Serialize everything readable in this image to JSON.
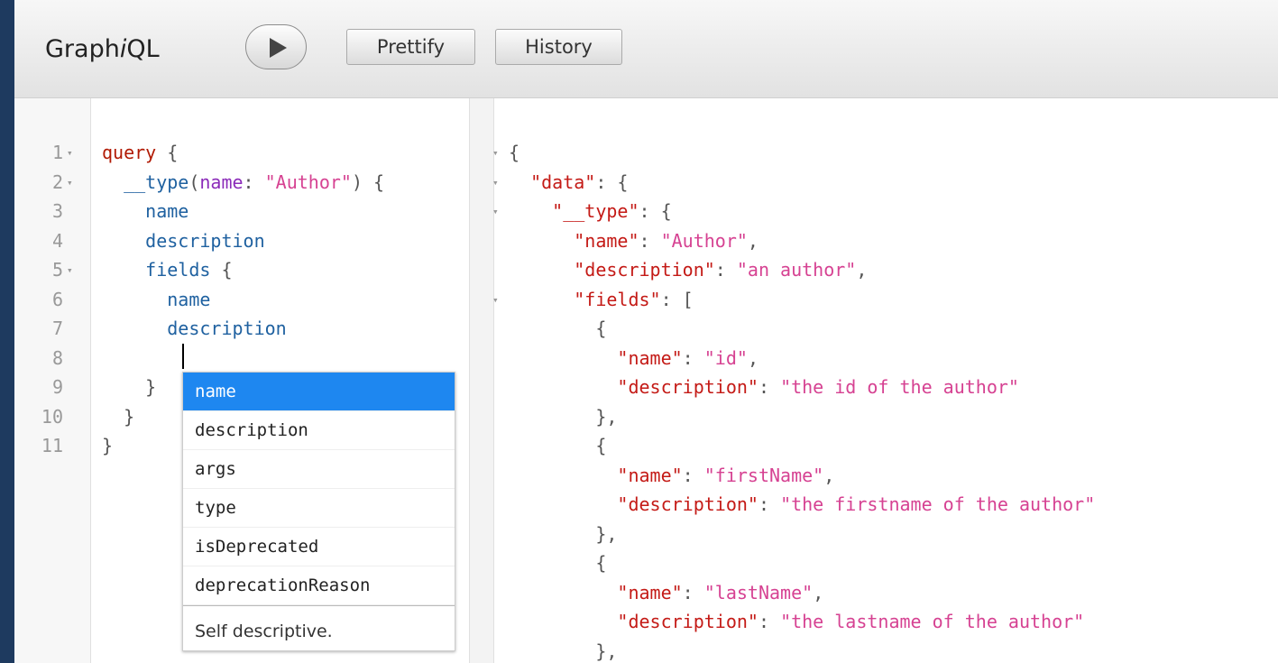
{
  "toolbar": {
    "logo_prefix": "Graph",
    "logo_i": "i",
    "logo_suffix": "QL",
    "prettify_label": "Prettify",
    "history_label": "History"
  },
  "editor": {
    "line_numbers": [
      "1",
      "2",
      "3",
      "4",
      "5",
      "6",
      "7",
      "8",
      "9",
      "10",
      "11"
    ],
    "lines": [
      [
        "query",
        " {"
      ],
      [
        "  __type",
        "(",
        "name",
        ": ",
        "\"Author\"",
        ") {"
      ],
      [
        "    name"
      ],
      [
        "    description"
      ],
      [
        "    fields",
        " {"
      ],
      [
        "      name"
      ],
      [
        "      description"
      ],
      [
        ""
      ],
      [
        "    }"
      ],
      [
        "  }"
      ],
      [
        "}"
      ]
    ]
  },
  "autocomplete": {
    "items": [
      "name",
      "description",
      "args",
      "type",
      "isDeprecated",
      "deprecationReason"
    ],
    "description": "Self descriptive."
  },
  "result": {
    "lines": [
      "{",
      "  \"data\": {",
      "    \"__type\": {",
      "      \"name\": \"Author\",",
      "      \"description\": \"an author\",",
      "      \"fields\": [",
      "        {",
      "          \"name\": \"id\",",
      "          \"description\": \"the id of the author\"",
      "        },",
      "        {",
      "          \"name\": \"firstName\",",
      "          \"description\": \"the firstname of the author\"",
      "        },",
      "        {",
      "          \"name\": \"lastName\",",
      "          \"description\": \"the lastname of the author\"",
      "        },"
    ],
    "folded_lines": [
      0,
      1,
      2,
      5
    ]
  },
  "colors": {
    "keyword": "#b11a04",
    "field": "#1f61a0",
    "attribute": "#8b2bb9",
    "string": "#d64292",
    "key": "#c41a16",
    "selection": "#1e87f0"
  }
}
